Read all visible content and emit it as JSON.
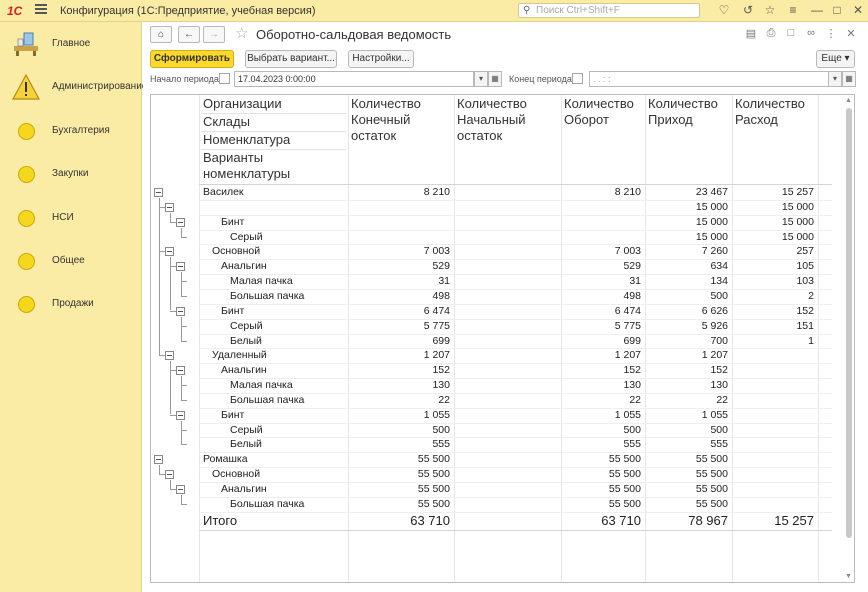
{
  "app": {
    "title": "Конфигурация  (1С:Предприятие, учебная версия)",
    "logo": "1С"
  },
  "search": {
    "placeholder": "Поиск Ctrl+Shift+F"
  },
  "sidebar": {
    "items": [
      {
        "label": "Главное",
        "icon": "desk-icon"
      },
      {
        "label": "Администрирование",
        "icon": "warning-icon"
      },
      {
        "label": "Бухгалтерия",
        "icon": "circle-icon"
      },
      {
        "label": "Закупки",
        "icon": "circle-icon"
      },
      {
        "label": "НСИ",
        "icon": "circle-icon"
      },
      {
        "label": "Общее",
        "icon": "circle-icon"
      },
      {
        "label": "Продажи",
        "icon": "circle-icon"
      }
    ]
  },
  "page": {
    "title": "Оборотно-сальдовая ведомость"
  },
  "toolbar": {
    "generate": "Сформировать",
    "choose_variant": "Выбрать вариант...",
    "settings": "Настройки...",
    "more": "Еще"
  },
  "period": {
    "start_label": "Начало периода:",
    "start_value": "17.04.2023  0:00:00",
    "end_label": "Конец периода:",
    "end_value": "  .  .        :  :  "
  },
  "report": {
    "group_headers": [
      "Организации",
      "Склады",
      "Номенклатура",
      "Варианты номенклатуры"
    ],
    "columns": [
      "Количество Конечный остаток",
      "Количество Начальный остаток",
      "Количество Оборот",
      "Количество Приход",
      "Количество Расход"
    ],
    "rows": [
      {
        "name": "Василек",
        "level": 0,
        "values": [
          "8 210",
          "",
          "8 210",
          "23 467",
          "15 257"
        ]
      },
      {
        "name": "",
        "level": 1,
        "values": [
          "",
          "",
          "",
          "15 000",
          "15 000"
        ]
      },
      {
        "name": "Бинт",
        "level": 2,
        "values": [
          "",
          "",
          "",
          "15 000",
          "15 000"
        ]
      },
      {
        "name": "Серый",
        "level": 3,
        "values": [
          "",
          "",
          "",
          "15 000",
          "15 000"
        ]
      },
      {
        "name": "Основной",
        "level": 1,
        "values": [
          "7 003",
          "",
          "7 003",
          "7 260",
          "257"
        ]
      },
      {
        "name": "Анальгин",
        "level": 2,
        "values": [
          "529",
          "",
          "529",
          "634",
          "105"
        ]
      },
      {
        "name": "Малая пачка",
        "level": 3,
        "values": [
          "31",
          "",
          "31",
          "134",
          "103"
        ]
      },
      {
        "name": "Большая пачка",
        "level": 3,
        "values": [
          "498",
          "",
          "498",
          "500",
          "2"
        ]
      },
      {
        "name": "Бинт",
        "level": 2,
        "values": [
          "6 474",
          "",
          "6 474",
          "6 626",
          "152"
        ]
      },
      {
        "name": "Серый",
        "level": 3,
        "values": [
          "5 775",
          "",
          "5 775",
          "5 926",
          "151"
        ]
      },
      {
        "name": "Белый",
        "level": 3,
        "values": [
          "699",
          "",
          "699",
          "700",
          "1"
        ]
      },
      {
        "name": "Удаленный",
        "level": 1,
        "values": [
          "1 207",
          "",
          "1 207",
          "1 207",
          ""
        ]
      },
      {
        "name": "Анальгин",
        "level": 2,
        "values": [
          "152",
          "",
          "152",
          "152",
          ""
        ]
      },
      {
        "name": "Малая пачка",
        "level": 3,
        "values": [
          "130",
          "",
          "130",
          "130",
          ""
        ]
      },
      {
        "name": "Большая пачка",
        "level": 3,
        "values": [
          "22",
          "",
          "22",
          "22",
          ""
        ]
      },
      {
        "name": "Бинт",
        "level": 2,
        "values": [
          "1 055",
          "",
          "1 055",
          "1 055",
          ""
        ]
      },
      {
        "name": "Серый",
        "level": 3,
        "values": [
          "500",
          "",
          "500",
          "500",
          ""
        ]
      },
      {
        "name": "Белый",
        "level": 3,
        "values": [
          "555",
          "",
          "555",
          "555",
          ""
        ]
      },
      {
        "name": "Ромашка",
        "level": 0,
        "values": [
          "55 500",
          "",
          "55 500",
          "55 500",
          ""
        ]
      },
      {
        "name": "Основной",
        "level": 1,
        "values": [
          "55 500",
          "",
          "55 500",
          "55 500",
          ""
        ]
      },
      {
        "name": "Анальгин",
        "level": 2,
        "values": [
          "55 500",
          "",
          "55 500",
          "55 500",
          ""
        ]
      },
      {
        "name": "Большая пачка",
        "level": 3,
        "values": [
          "55 500",
          "",
          "55 500",
          "55 500",
          ""
        ]
      }
    ],
    "total": {
      "label": "Итого",
      "values": [
        "63 710",
        "",
        "63 710",
        "78 967",
        "15 257"
      ]
    }
  },
  "colors": {
    "panel": "#fbeca5",
    "accent": "#fbd829",
    "logo": "#d9231e"
  }
}
